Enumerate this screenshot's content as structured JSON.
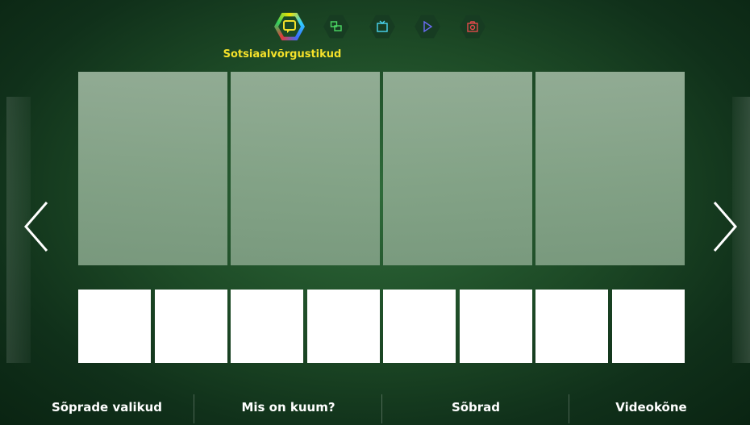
{
  "colors": {
    "accent": "#f5e12a",
    "tile_light": "#ffffff",
    "tile_preview": "#8fac91"
  },
  "top_nav": {
    "items": [
      {
        "icon": "social-chat-icon",
        "active": true
      },
      {
        "icon": "multi-screen-icon",
        "active": false
      },
      {
        "icon": "tv-icon",
        "active": false
      },
      {
        "icon": "play-icon",
        "active": false
      },
      {
        "icon": "camera-icon",
        "active": false
      }
    ],
    "active_label": "Sotsiaalvõrgustikud"
  },
  "big_tiles": [
    {},
    {},
    {},
    {}
  ],
  "small_tiles": [
    {},
    {},
    {},
    {},
    {},
    {},
    {},
    {}
  ],
  "bottom_menu": {
    "items": [
      {
        "label": "Sõprade valikud"
      },
      {
        "label": "Mis on kuum?"
      },
      {
        "label": "Sõbrad"
      },
      {
        "label": "Videokõne"
      }
    ]
  }
}
